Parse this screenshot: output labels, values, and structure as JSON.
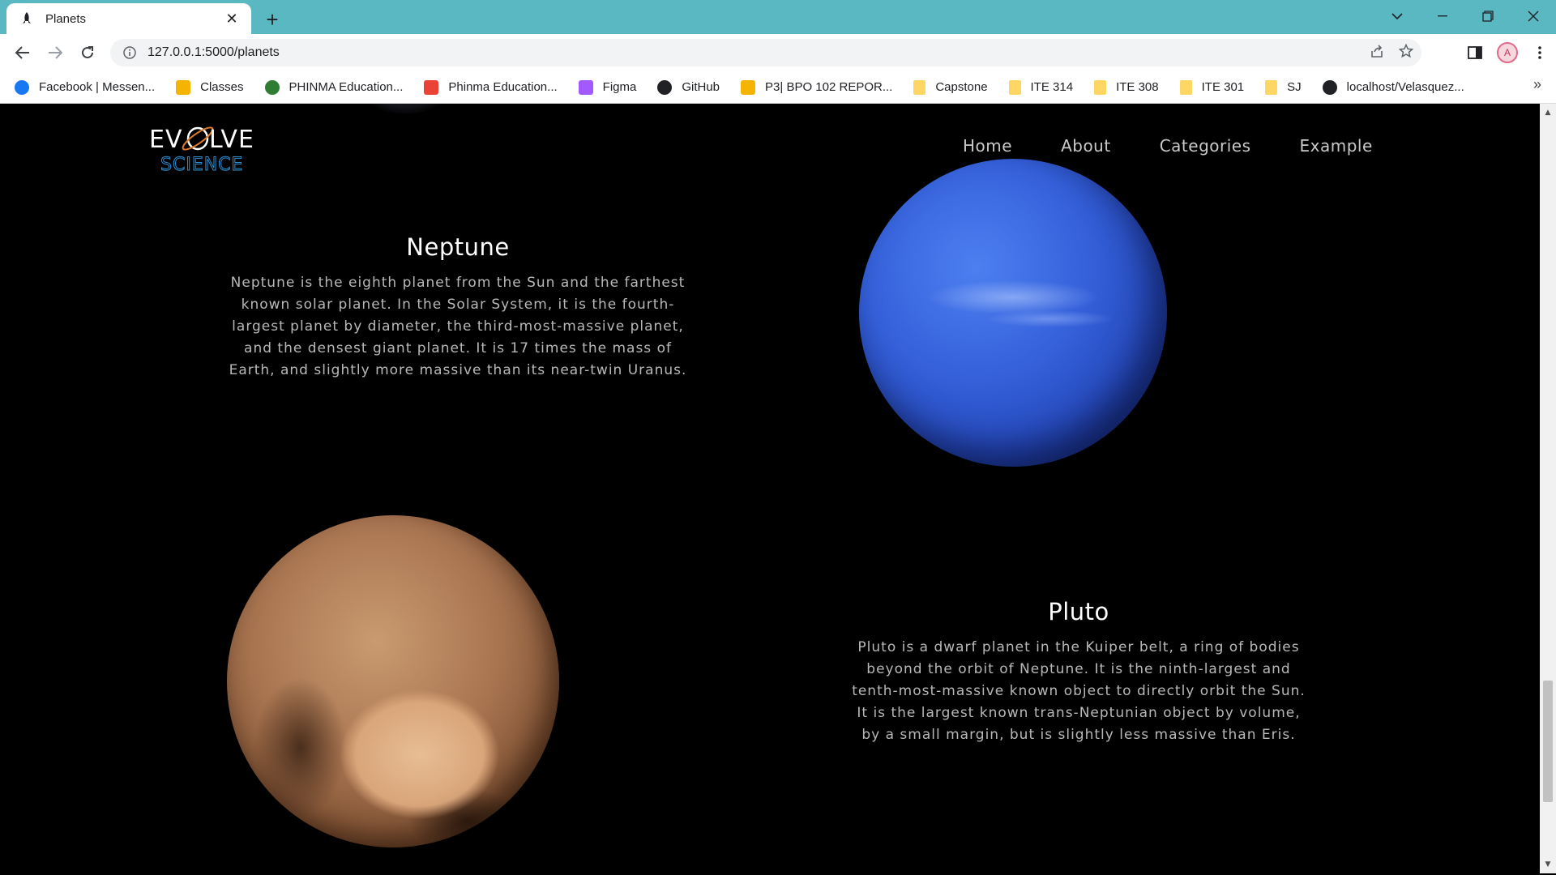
{
  "browser": {
    "tab_title": "Planets",
    "url": "127.0.0.1:5000/planets",
    "bookmarks": [
      {
        "label": "Facebook | Messen...",
        "icon": "facebook-icon",
        "color": "#1877f2"
      },
      {
        "label": "Classes",
        "icon": "classroom-icon",
        "color": "#f4b400"
      },
      {
        "label": "PHINMA Education...",
        "icon": "globe-icon",
        "color": "#2e7d32"
      },
      {
        "label": "Phinma Education...",
        "icon": "gmail-icon",
        "color": "#ea4335"
      },
      {
        "label": "Figma",
        "icon": "figma-icon",
        "color": "#a259ff"
      },
      {
        "label": "GitHub",
        "icon": "github-icon",
        "color": "#202124"
      },
      {
        "label": "P3| BPO 102 REPOR...",
        "icon": "slides-icon",
        "color": "#f4b400"
      },
      {
        "label": "Capstone",
        "icon": "folder-icon",
        "color": "#fdd663"
      },
      {
        "label": "ITE 314",
        "icon": "folder-icon",
        "color": "#fdd663"
      },
      {
        "label": "ITE 308",
        "icon": "folder-icon",
        "color": "#fdd663"
      },
      {
        "label": "ITE 301",
        "icon": "folder-icon",
        "color": "#fdd663"
      },
      {
        "label": "SJ",
        "icon": "folder-icon",
        "color": "#fdd663"
      },
      {
        "label": "localhost/Velasquez...",
        "icon": "globe-icon",
        "color": "#202124"
      }
    ],
    "more_bookmarks": "»"
  },
  "site": {
    "nav": [
      "Home",
      "About",
      "Categories",
      "Example"
    ]
  },
  "planets": [
    {
      "name": "Neptune",
      "description": "Neptune is the eighth planet from the Sun and the farthest known solar planet. In the Solar System, it is the fourth-largest planet by diameter, the third-most-massive planet, and the densest giant planet. It is 17 times the mass of Earth, and slightly more massive than its near-twin Uranus.",
      "color": "#3a66e0"
    },
    {
      "name": "Pluto",
      "description": "Pluto is a dwarf planet in the Kuiper belt, a ring of bodies beyond the orbit of Neptune. It is the ninth-largest and tenth-most-massive known object to directly orbit the Sun. It is the largest known trans-Neptunian object by volume, by a small margin, but is slightly less massive than Eris.",
      "color": "#c9946a"
    }
  ],
  "colors": {
    "tabstrip": "#5ab8c2",
    "page_bg": "#000000",
    "nav_text": "#c9c9c9"
  }
}
